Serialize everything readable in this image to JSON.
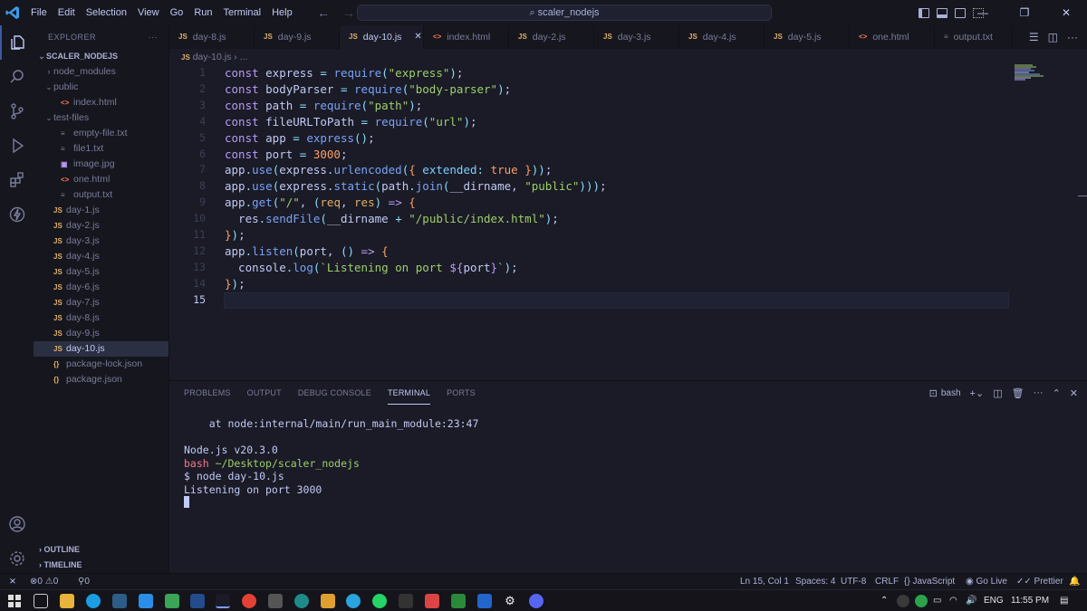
{
  "titlebar": {
    "menu": [
      "File",
      "Edit",
      "Selection",
      "View",
      "Go",
      "Run",
      "Terminal",
      "Help"
    ],
    "search_text": "scaler_nodejs"
  },
  "sidebar": {
    "title": "EXPLORER",
    "more": "···",
    "root": "SCALER_NODEJS",
    "items": [
      {
        "label": "node_modules",
        "type": "folder",
        "indent": 1,
        "open": false
      },
      {
        "label": "public",
        "type": "folder",
        "indent": 1,
        "open": true
      },
      {
        "label": "index.html",
        "type": "html",
        "indent": 2
      },
      {
        "label": "test-files",
        "type": "folder",
        "indent": 1,
        "open": true
      },
      {
        "label": "empty-file.txt",
        "type": "txt",
        "indent": 2
      },
      {
        "label": "file1.txt",
        "type": "txt",
        "indent": 2
      },
      {
        "label": "image.jpg",
        "type": "img",
        "indent": 2
      },
      {
        "label": "one.html",
        "type": "html",
        "indent": 2
      },
      {
        "label": "output.txt",
        "type": "txt",
        "indent": 2
      },
      {
        "label": "day-1.js",
        "type": "js",
        "indent": 1
      },
      {
        "label": "day-2.js",
        "type": "js",
        "indent": 1
      },
      {
        "label": "day-3.js",
        "type": "js",
        "indent": 1
      },
      {
        "label": "day-4.js",
        "type": "js",
        "indent": 1
      },
      {
        "label": "day-5.js",
        "type": "js",
        "indent": 1
      },
      {
        "label": "day-6.js",
        "type": "js",
        "indent": 1
      },
      {
        "label": "day-7.js",
        "type": "js",
        "indent": 1
      },
      {
        "label": "day-8.js",
        "type": "js",
        "indent": 1
      },
      {
        "label": "day-9.js",
        "type": "js",
        "indent": 1
      },
      {
        "label": "day-10.js",
        "type": "js",
        "indent": 1,
        "selected": true
      },
      {
        "label": "package-lock.json",
        "type": "json",
        "indent": 1
      },
      {
        "label": "package.json",
        "type": "json",
        "indent": 1
      }
    ],
    "outline": "OUTLINE",
    "timeline": "TIMELINE"
  },
  "tabs": [
    {
      "label": "day-8.js",
      "type": "js"
    },
    {
      "label": "day-9.js",
      "type": "js"
    },
    {
      "label": "day-10.js",
      "type": "js",
      "active": true
    },
    {
      "label": "index.html",
      "type": "html"
    },
    {
      "label": "day-2.js",
      "type": "js"
    },
    {
      "label": "day-3.js",
      "type": "js"
    },
    {
      "label": "day-4.js",
      "type": "js"
    },
    {
      "label": "day-5.js",
      "type": "js"
    },
    {
      "label": "one.html",
      "type": "html"
    },
    {
      "label": "output.txt",
      "type": "txt"
    }
  ],
  "breadcrumb": {
    "icon": "JS",
    "file": "day-10.js",
    "sep": "›",
    "more": "..."
  },
  "editor": {
    "current_line": 15,
    "lines": [
      [
        [
          "k",
          "const "
        ],
        [
          "v",
          "express "
        ],
        [
          "o",
          "= "
        ],
        [
          "f",
          "require"
        ],
        [
          "p",
          "("
        ],
        [
          "s",
          "\"express\""
        ],
        [
          "p",
          ")"
        ],
        [
          "v",
          ";"
        ]
      ],
      [
        [
          "k",
          "const "
        ],
        [
          "v",
          "bodyParser "
        ],
        [
          "o",
          "= "
        ],
        [
          "f",
          "require"
        ],
        [
          "p",
          "("
        ],
        [
          "s",
          "\"body-parser\""
        ],
        [
          "p",
          ")"
        ],
        [
          "v",
          ";"
        ]
      ],
      [
        [
          "k",
          "const "
        ],
        [
          "v",
          "path "
        ],
        [
          "o",
          "= "
        ],
        [
          "f",
          "require"
        ],
        [
          "p",
          "("
        ],
        [
          "s",
          "\"path\""
        ],
        [
          "p",
          ")"
        ],
        [
          "v",
          ";"
        ]
      ],
      [
        [
          "k",
          "const "
        ],
        [
          "v",
          "fileURLToPath "
        ],
        [
          "o",
          "= "
        ],
        [
          "f",
          "require"
        ],
        [
          "p",
          "("
        ],
        [
          "s",
          "\"url\""
        ],
        [
          "p",
          ")"
        ],
        [
          "v",
          ";"
        ]
      ],
      [
        [
          "k",
          "const "
        ],
        [
          "v",
          "app "
        ],
        [
          "o",
          "= "
        ],
        [
          "f",
          "express"
        ],
        [
          "p",
          "()"
        ],
        [
          "v",
          ";"
        ]
      ],
      [
        [
          "k",
          "const "
        ],
        [
          "v",
          "port "
        ],
        [
          "o",
          "= "
        ],
        [
          "n",
          "3000"
        ],
        [
          "v",
          ";"
        ]
      ],
      [
        [
          "v",
          "app"
        ],
        [
          "o",
          "."
        ],
        [
          "f",
          "use"
        ],
        [
          "p",
          "("
        ],
        [
          "v",
          "express"
        ],
        [
          "o",
          "."
        ],
        [
          "f",
          "urlencoded"
        ],
        [
          "p",
          "("
        ],
        [
          "b",
          "{ "
        ],
        [
          "pr",
          "extended"
        ],
        [
          "o",
          ": "
        ],
        [
          "n",
          "true "
        ],
        [
          "b",
          "}"
        ],
        [
          "p",
          ")"
        ],
        [
          "p",
          ")"
        ],
        [
          "v",
          ";"
        ]
      ],
      [
        [
          "v",
          "app"
        ],
        [
          "o",
          "."
        ],
        [
          "f",
          "use"
        ],
        [
          "p",
          "("
        ],
        [
          "v",
          "express"
        ],
        [
          "o",
          "."
        ],
        [
          "f",
          "static"
        ],
        [
          "p",
          "("
        ],
        [
          "v",
          "path"
        ],
        [
          "o",
          "."
        ],
        [
          "f",
          "join"
        ],
        [
          "p",
          "("
        ],
        [
          "v",
          "__dirname"
        ],
        [
          "v",
          ", "
        ],
        [
          "s",
          "\"public\""
        ],
        [
          "p",
          ")"
        ],
        [
          "p",
          ")"
        ],
        [
          "p",
          ")"
        ],
        [
          "v",
          ";"
        ]
      ],
      [
        [
          "v",
          "app"
        ],
        [
          "o",
          "."
        ],
        [
          "f",
          "get"
        ],
        [
          "p",
          "("
        ],
        [
          "s",
          "\"/\""
        ],
        [
          "v",
          ", "
        ],
        [
          "p",
          "("
        ],
        [
          "t",
          "req"
        ],
        [
          "v",
          ", "
        ],
        [
          "t",
          "res"
        ],
        [
          "p",
          ") "
        ],
        [
          "k",
          "=> "
        ],
        [
          "b",
          "{"
        ]
      ],
      [
        [
          "v",
          "  res"
        ],
        [
          "o",
          "."
        ],
        [
          "f",
          "sendFile"
        ],
        [
          "p",
          "("
        ],
        [
          "v",
          "__dirname "
        ],
        [
          "o",
          "+ "
        ],
        [
          "s",
          "\"/public/index.html\""
        ],
        [
          "p",
          ")"
        ],
        [
          "v",
          ";"
        ]
      ],
      [
        [
          "b",
          "}"
        ],
        [
          "p",
          ")"
        ],
        [
          "v",
          ";"
        ]
      ],
      [
        [
          "v",
          "app"
        ],
        [
          "o",
          "."
        ],
        [
          "f",
          "listen"
        ],
        [
          "p",
          "("
        ],
        [
          "v",
          "port"
        ],
        [
          "v",
          ", "
        ],
        [
          "p",
          "() "
        ],
        [
          "k",
          "=> "
        ],
        [
          "b",
          "{"
        ]
      ],
      [
        [
          "v",
          "  console"
        ],
        [
          "o",
          "."
        ],
        [
          "f",
          "log"
        ],
        [
          "p",
          "("
        ],
        [
          "s",
          "`Listening on port "
        ],
        [
          "k",
          "${"
        ],
        [
          "v",
          "port"
        ],
        [
          "k",
          "}"
        ],
        [
          "s",
          "`"
        ],
        [
          "p",
          ")"
        ],
        [
          "v",
          ";"
        ]
      ],
      [
        [
          "b",
          "}"
        ],
        [
          "p",
          ")"
        ],
        [
          "v",
          ";"
        ]
      ],
      []
    ]
  },
  "panel": {
    "tabs": [
      "PROBLEMS",
      "OUTPUT",
      "DEBUG CONSOLE",
      "TERMINAL",
      "PORTS"
    ],
    "active_tab": "TERMINAL",
    "terminal_name": "bash",
    "terminal_lines": [
      "    at node:internal/main/run_main_module:23:47",
      "",
      "Node.js v20.3.0",
      "bash ~/Desktop/scaler_nodejs",
      "$ node day-10.js",
      "Listening on port 3000"
    ]
  },
  "statusbar": {
    "errors": "0",
    "warnings": "0",
    "ports": "0",
    "position": "Ln 15, Col 1",
    "spaces": "Spaces: 4",
    "encoding": "UTF-8",
    "eol": "CRLF",
    "language": "JavaScript",
    "golive": "Go Live",
    "prettier": "Prettier"
  },
  "taskbar": {
    "language": "ENG",
    "time": "11:55 PM"
  },
  "colors": {
    "background": "#1a1b26",
    "sidebar": "#16161e",
    "keyword": "#bb9af7",
    "string": "#9ece6a",
    "function": "#7aa2f7",
    "number": "#ff9e64",
    "accent": "#3d59a1"
  }
}
